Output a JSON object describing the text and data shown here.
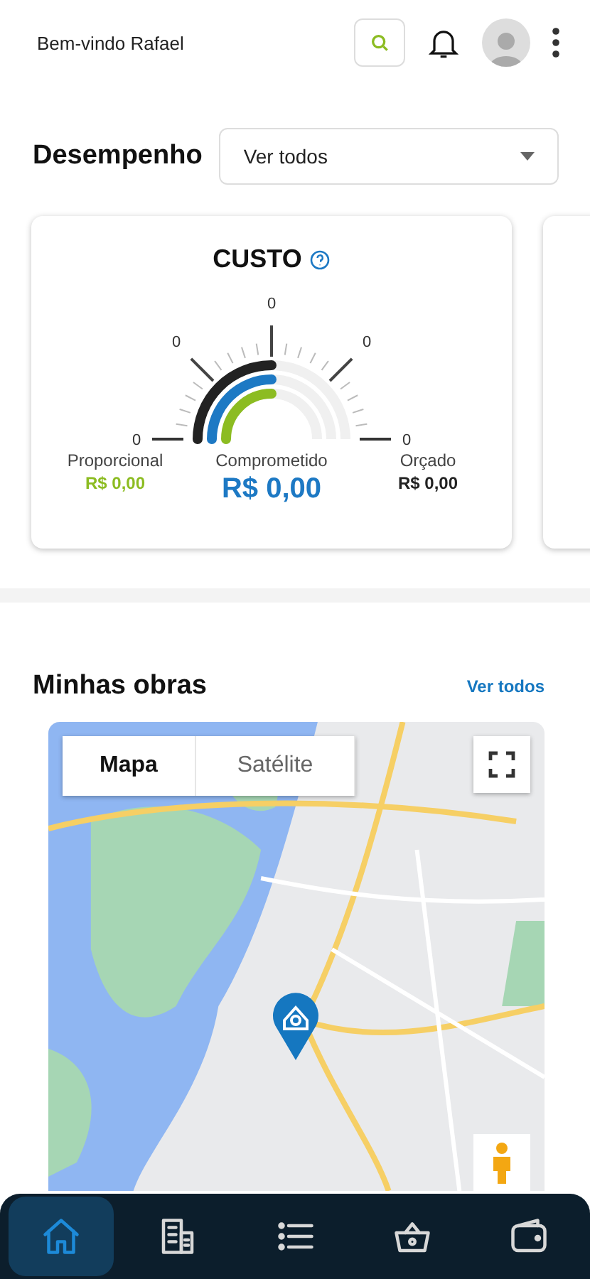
{
  "header": {
    "greeting": "Bem-vindo Rafael"
  },
  "performance": {
    "title": "Desempenho",
    "filter": {
      "value": "Ver todos"
    }
  },
  "cost_card": {
    "title": "CUSTO",
    "gauge_labels": [
      "0",
      "0",
      "0",
      "0",
      "0"
    ],
    "metrics": [
      {
        "label": "Proporcional",
        "value": "R$ 0,00",
        "kind": "proportional"
      },
      {
        "label": "Comprometido",
        "value": "R$ 0,00",
        "kind": "committed"
      },
      {
        "label": "Orçado",
        "value": "R$ 0,00",
        "kind": "budgeted"
      }
    ]
  },
  "works": {
    "title": "Minhas obras",
    "link": "Ver todos",
    "map": {
      "kind": "picture",
      "tabs": [
        {
          "label": "Mapa",
          "selected": true
        },
        {
          "label": "Satélite",
          "selected": false
        }
      ]
    }
  },
  "bottom_nav": [
    {
      "kind": "home",
      "selected": true
    },
    {
      "kind": "buildings",
      "selected": false
    },
    {
      "kind": "list",
      "selected": false
    },
    {
      "kind": "basket",
      "selected": false
    },
    {
      "kind": "wallet",
      "selected": false
    }
  ]
}
